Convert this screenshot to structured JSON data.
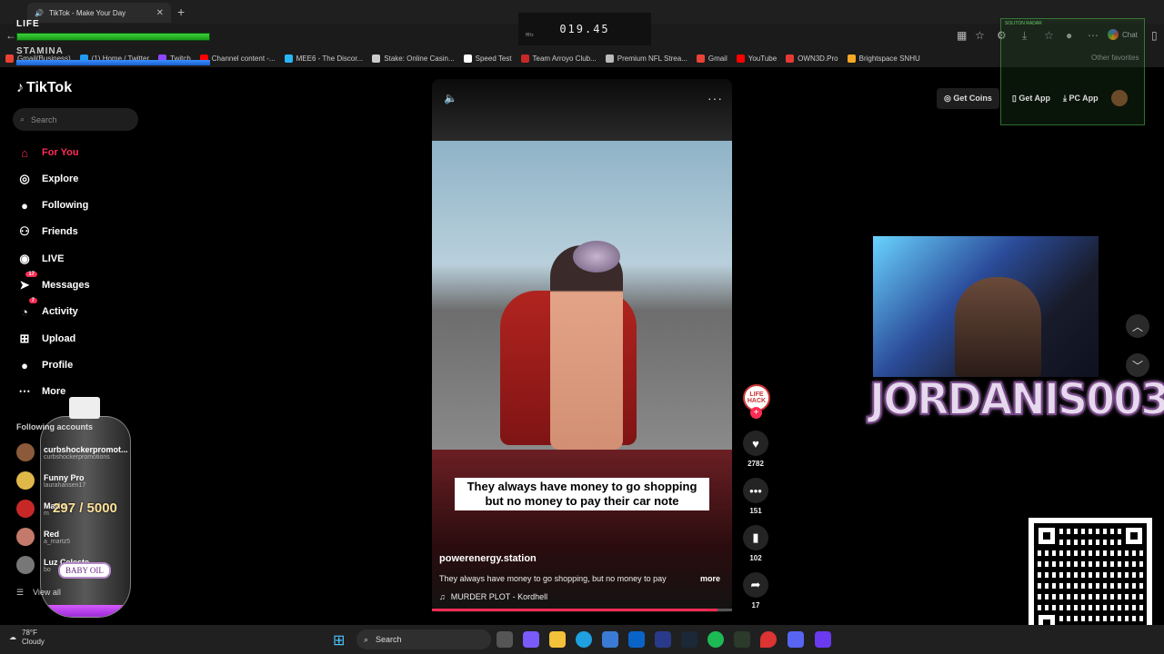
{
  "browser": {
    "tab_title": "TikTok - Make Your Day",
    "bookmarks": [
      {
        "label": "Gmail(Business)",
        "color": "#ea4335"
      },
      {
        "label": "(1) Home / Twitter",
        "color": "#1d9bf0"
      },
      {
        "label": "Twitch",
        "color": "#9146ff"
      },
      {
        "label": "Channel content -...",
        "color": "#ff0000"
      },
      {
        "label": "MEE6 - The Discor...",
        "color": "#29b6f6"
      },
      {
        "label": "Stake: Online Casin...",
        "color": "#cccccc"
      },
      {
        "label": "Speed Test",
        "color": "#ffffff"
      },
      {
        "label": "Team Arroyo Club...",
        "color": "#c62828"
      },
      {
        "label": "Premium NFL Strea...",
        "color": "#bbbbbb"
      },
      {
        "label": "Gmail",
        "color": "#ea4335"
      },
      {
        "label": "YouTube",
        "color": "#ff0000"
      },
      {
        "label": "OWN3D.Pro",
        "color": "#e53935"
      },
      {
        "label": "Brightspace SNHU",
        "color": "#f9a825"
      }
    ],
    "other_bookmarks": "Other favorites",
    "chat_label": "Chat"
  },
  "overlay": {
    "life_label": "LIFE",
    "stamina_label": "STAMINA",
    "timer": "019.45",
    "timer_unit": "MHz",
    "radar_label": "SOLITON RADAR",
    "streamer_name": "JORDANIS003",
    "bottle_count": "297 / 5000",
    "bottle_level": 0.06,
    "bottle_label": "BABY OIL"
  },
  "sidebar": {
    "logo": "TikTok",
    "search_placeholder": "Search",
    "nav": [
      {
        "label": "For You",
        "icon": "home-icon",
        "active": true
      },
      {
        "label": "Explore",
        "icon": "compass-icon"
      },
      {
        "label": "Following",
        "icon": "avatar-icon"
      },
      {
        "label": "Friends",
        "icon": "friends-icon"
      },
      {
        "label": "LIVE",
        "icon": "live-icon"
      },
      {
        "label": "Messages",
        "icon": "send-icon",
        "badge": "17"
      },
      {
        "label": "Activity",
        "icon": "bell-icon",
        "badge": "7"
      },
      {
        "label": "Upload",
        "icon": "plus-square-icon"
      },
      {
        "label": "Profile",
        "icon": "profile-avatar-icon"
      },
      {
        "label": "More",
        "icon": "more-dots-icon"
      }
    ],
    "following_title": "Following accounts",
    "accounts": [
      {
        "name": "curbshockerpromot...",
        "handle": "curbshockerpromotions"
      },
      {
        "name": "Funny Pro",
        "handle": "laurahansen17"
      },
      {
        "name": "Mario",
        "handle": "m"
      },
      {
        "name": "Red",
        "handle": "a_martz5"
      },
      {
        "name": "Luz Celeste",
        "handle": "bo"
      }
    ],
    "view_all": "View all"
  },
  "video": {
    "caption": "They always have money to go shopping but no money to pay their car note",
    "author": "powerenergy.station",
    "description": "They always have money to go shopping, but no money to pay",
    "more": "more",
    "music": "MURDER PLOT - Kordhell",
    "creator_badge": "LIFE HACK",
    "likes": "2782",
    "comments": "151",
    "saves": "102",
    "shares": "17",
    "progress": 0.95
  },
  "header": {
    "get_coins": "Get Coins",
    "get_app": "Get App",
    "pc_app": "PC App"
  },
  "taskbar": {
    "temperature": "78°F",
    "condition": "Cloudy",
    "search": "Search"
  }
}
